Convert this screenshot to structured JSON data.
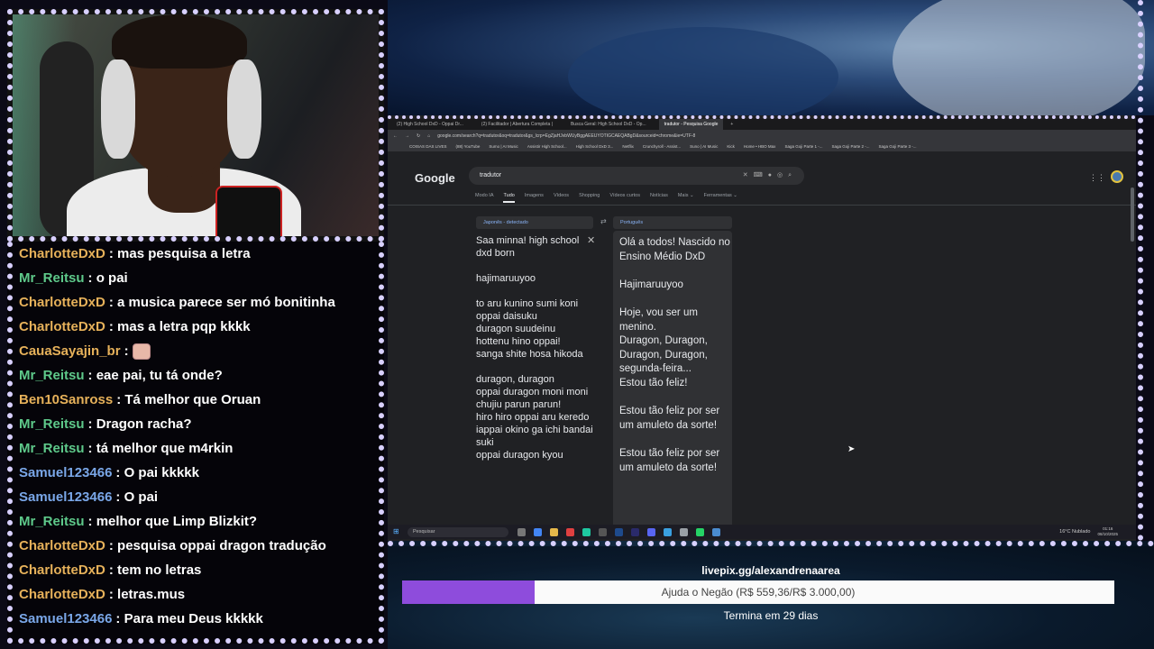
{
  "chat": {
    "messages": [
      {
        "user": "CharlotteDxD",
        "color": "#e6b15a",
        "text": "mas pesquisa a letra"
      },
      {
        "user": "Mr_Reitsu",
        "color": "#5ec98a",
        "text": "o pai"
      },
      {
        "user": "CharlotteDxD",
        "color": "#e6b15a",
        "text": "a musica parece ser mó bonitinha"
      },
      {
        "user": "CharlotteDxD",
        "color": "#e6b15a",
        "text": "mas a letra pqp kkkk"
      },
      {
        "user": "CauaSayajin_br",
        "color": "#e6b15a",
        "text": "",
        "emote": true
      },
      {
        "user": "Mr_Reitsu",
        "color": "#5ec98a",
        "text": "eae pai, tu tá onde?"
      },
      {
        "user": "Ben10Sanross",
        "color": "#e6b15a",
        "text": "Tá melhor que Oruan"
      },
      {
        "user": "Mr_Reitsu",
        "color": "#5ec98a",
        "text": "Dragon racha?"
      },
      {
        "user": "Mr_Reitsu",
        "color": "#5ec98a",
        "text": "tá melhor que m4rkin"
      },
      {
        "user": "Samuel123466",
        "color": "#7aa7e8",
        "text": "O pai kkkkk"
      },
      {
        "user": "Samuel123466",
        "color": "#7aa7e8",
        "text": "O pai"
      },
      {
        "user": "Mr_Reitsu",
        "color": "#5ec98a",
        "text": "melhor que Limp Blizkit?"
      },
      {
        "user": "CharlotteDxD",
        "color": "#e6b15a",
        "text": "pesquisa oppai dragon tradução"
      },
      {
        "user": "CharlotteDxD",
        "color": "#e6b15a",
        "text": "tem no letras"
      },
      {
        "user": "CharlotteDxD",
        "color": "#e6b15a",
        "text": "letras.mus"
      },
      {
        "user": "Samuel123466",
        "color": "#7aa7e8",
        "text": "Para meu Deus kkkkk"
      }
    ]
  },
  "browser": {
    "tabs": [
      "(2) High School DxD - Oppai Dr...",
      "(2) Facilitador | Abertura Completa |",
      "Busca Geral: High School DxD - Op...",
      "tradutor - Pesquisa Google"
    ],
    "active_tab": 3,
    "url": "google.com/search?q=tradutor&oq=tradutor&gs_lcrp=EgZjaHJvbWUyBggAEEUYOTIGCAEQABgD&sourceid=chrome&ie=UTF-8",
    "bookmarks": [
      "COISAS DAS LIVES",
      "(88) YouTube",
      "Sumo | AI Music",
      "Assistir High School...",
      "High School DxD 3...",
      "Netflix",
      "Crunchyroll - Assist...",
      "Suno | AI Music",
      "Kick",
      "Home • HBO Max",
      "Saga Goji Parte 1 -...",
      "Saga Goji Parte 2 -...",
      "Saga Goji Parte 3 -..."
    ],
    "google": {
      "logo": "Google",
      "query": "tradutor",
      "nav": [
        "Modo IA",
        "Tudo",
        "Imagens",
        "Vídeos",
        "Shopping",
        "Vídeos curtos",
        "Notícias",
        "Mais ⌄",
        "Ferramentas ⌄"
      ],
      "nav_active": 1,
      "source_lang": "Japonês - detectado",
      "target_lang": "Português",
      "source_text": "Saa minna! high school dxd born\n\nhajimaruuyoo\n\nto aru kunino sumi koni\noppai daisuku\nduragon suudeinu\nhottenu hino oppai!\nsanga shite hosa hikoda\n\nduragon, duragon\noppai duragon moni moni chujiu parun parun!\nhiro hiro oppai aru keredo\niappai okino ga ichi bandai suki\noppai duragon kyou",
      "target_text": "Olá a todos! Nascido no Ensino Médio DxD\n\nHajimaruuyoo\n\nHoje, vou ser um menino.\nDuragon, Duragon, Duragon, Duragon, segunda-feira...\nEstou tão feliz!\n\nEstou tão feliz por ser um amuleto da sorte!\n\nEstou tão feliz por ser um amuleto da sorte!"
    }
  },
  "taskbar": {
    "search_placeholder": "Pesquisar",
    "weather": "16°C  Nublado",
    "time": "01:16",
    "date": "08/10/2025"
  },
  "goal": {
    "link": "livepix.gg/alexandrenaarea",
    "text": "Ajuda o Negão (R$ 559,36/R$ 3.000,00)",
    "current": 559.36,
    "target": 3000,
    "ends": "Termina em 29 dias",
    "fill_color": "#8e4cdc"
  }
}
